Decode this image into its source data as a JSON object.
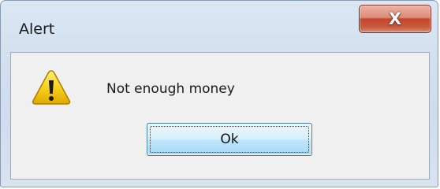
{
  "window": {
    "title": "Alert"
  },
  "titlebar": {
    "close_icon": "close-icon",
    "close_glyph": "X"
  },
  "dialog": {
    "icon": "warning-icon",
    "message": "Not enough money",
    "ok_label": "Ok"
  },
  "colors": {
    "close_button": "#c7452a",
    "ok_button": "#bee6fd",
    "warning_yellow": "#f5c400"
  }
}
